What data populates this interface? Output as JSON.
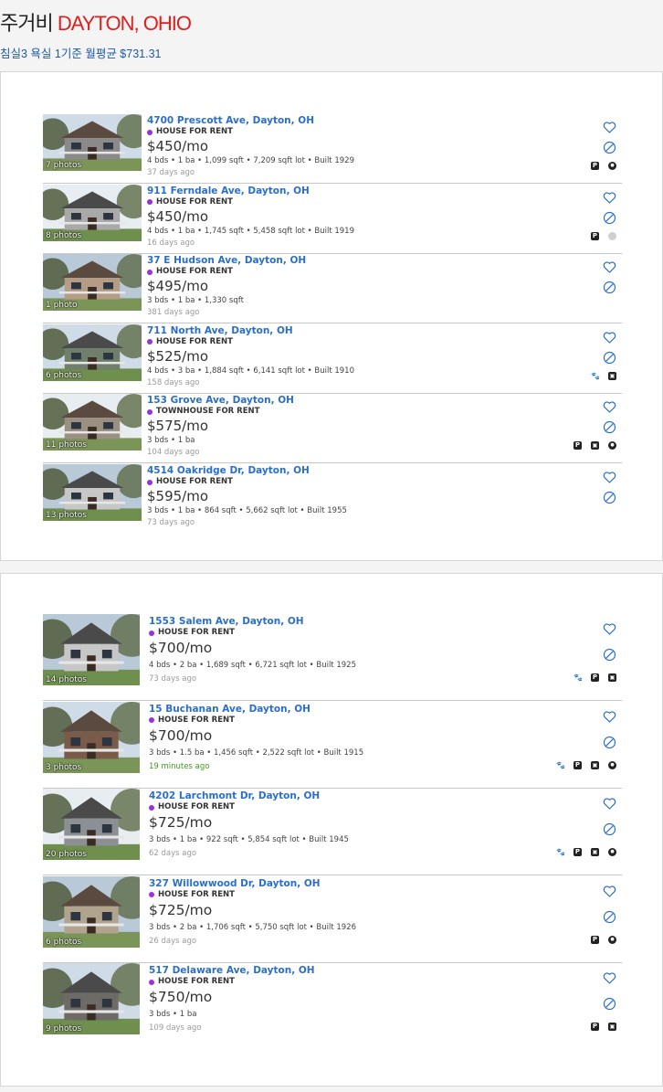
{
  "header": {
    "title_prefix": "주거비 ",
    "title_city": "DAYTON, OHIO",
    "subtitle": "침실3 욕실 1기준 월평균 $731.31"
  },
  "colors": {
    "accent_red": "#e01e1e",
    "link_blue": "#2a6fc9",
    "type_dot_purple": "#9b30d9",
    "fresh_green": "#3c9a1a"
  },
  "panel1": {
    "listings": [
      {
        "photos": "7 photos",
        "address": "4700 Prescott Ave, Dayton, OH",
        "type": "HOUSE FOR RENT",
        "price": "$450/mo",
        "details": "4 bds • 1 ba • 1,099 sqft • 7,209 sqft lot • Built 1929",
        "age": "37 days ago",
        "amenities": [
          "parking-icon",
          "laundry-icon"
        ]
      },
      {
        "photos": "8 photos",
        "address": "911 Ferndale Ave, Dayton, OH",
        "type": "HOUSE FOR RENT",
        "price": "$450/mo",
        "details": "4 bds • 1 ba • 1,745 sqft • 5,458 sqft lot • Built 1919",
        "age": "16 days ago",
        "amenities": [
          "parking-icon",
          "laundry-icon-grey"
        ]
      },
      {
        "photos": "1 photo",
        "address": "37 E Hudson Ave, Dayton, OH",
        "type": "HOUSE FOR RENT",
        "price": "$495/mo",
        "details": "3 bds • 1 ba • 1,330 sqft",
        "age": "381 days ago",
        "amenities": []
      },
      {
        "photos": "6 photos",
        "address": "711 North Ave, Dayton, OH",
        "type": "HOUSE FOR RENT",
        "price": "$525/mo",
        "details": "4 bds • 3 ba • 1,884 sqft • 6,141 sqft lot • Built 1910",
        "age": "158 days ago",
        "amenities": [
          "pets-icon",
          "appliance-icon"
        ]
      },
      {
        "photos": "11 photos",
        "address": "153 Grove Ave, Dayton, OH",
        "type": "TOWNHOUSE FOR RENT",
        "price": "$575/mo",
        "details": "3 bds • 1 ba",
        "age": "104 days ago",
        "amenities": [
          "parking-icon",
          "appliance-icon",
          "laundry-icon"
        ]
      },
      {
        "photos": "13 photos",
        "address": "4514 Oakridge Dr, Dayton, OH",
        "type": "HOUSE FOR RENT",
        "price": "$595/mo",
        "details": "3 bds • 1 ba • 864 sqft • 5,662 sqft lot • Built 1955",
        "age": "73 days ago",
        "amenities": []
      }
    ]
  },
  "panel2": {
    "listings": [
      {
        "photos": "14 photos",
        "address": "1553 Salem Ave, Dayton, OH",
        "type": "HOUSE FOR RENT",
        "price": "$700/mo",
        "details": "4 bds • 2 ba • 1,689 sqft • 6,721 sqft lot • Built 1925",
        "age": "73 days ago",
        "amenities": [
          "pets-icon",
          "parking-icon",
          "appliance-icon"
        ]
      },
      {
        "photos": "3 photos",
        "address": "15 Buchanan Ave, Dayton, OH",
        "type": "HOUSE FOR RENT",
        "price": "$700/mo",
        "details": "3 bds • 1.5 ba • 1,456 sqft • 2,522 sqft lot • Built 1915",
        "age": "19 minutes ago",
        "amenities": [
          "pets-icon",
          "parking-icon",
          "appliance-icon",
          "laundry-icon"
        ]
      },
      {
        "photos": "20 photos",
        "address": "4202 Larchmont Dr, Dayton, OH",
        "type": "HOUSE FOR RENT",
        "price": "$725/mo",
        "details": "3 bds • 1 ba • 922 sqft • 5,854 sqft lot • Built 1945",
        "age": "62 days ago",
        "amenities": [
          "pets-icon",
          "parking-icon",
          "appliance-icon",
          "laundry-icon"
        ]
      },
      {
        "photos": "6 photos",
        "address": "327 Willowwood Dr, Dayton, OH",
        "type": "HOUSE FOR RENT",
        "price": "$725/mo",
        "details": "3 bds • 2 ba • 1,706 sqft • 5,750 sqft lot • Built 1926",
        "age": "26 days ago",
        "amenities": [
          "parking-icon",
          "laundry-icon"
        ]
      },
      {
        "photos": "9 photos",
        "address": "517 Delaware Ave, Dayton, OH",
        "type": "HOUSE FOR RENT",
        "price": "$750/mo",
        "details": "3 bds • 1 ba",
        "age": "109 days ago",
        "amenities": [
          "parking-icon",
          "appliance-icon"
        ]
      }
    ]
  }
}
